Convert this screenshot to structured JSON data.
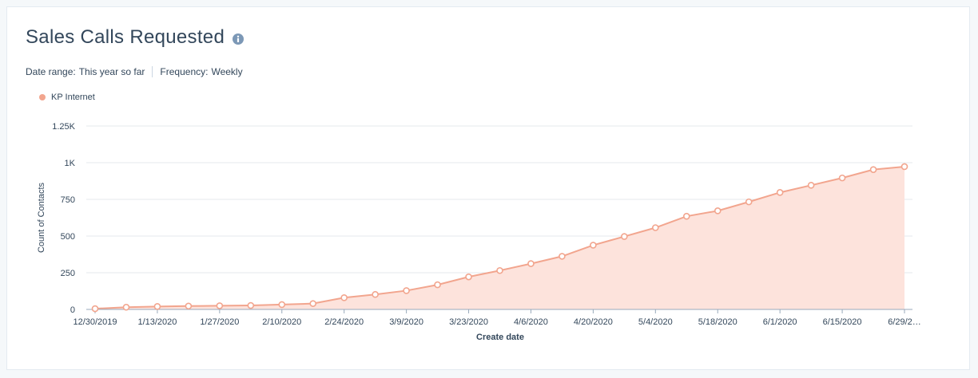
{
  "title": "Sales Calls Requested",
  "filters": {
    "date_range_label": "Date range:",
    "date_range_value": "This year so far",
    "frequency_label": "Frequency:",
    "frequency_value": "Weekly"
  },
  "colors": {
    "series_line": "#f2a58e",
    "series_fill": "#fde3dc",
    "grid": "#e5e9ee",
    "axis": "#99aabb",
    "info_icon": "#7c98b6"
  },
  "chart_data": {
    "type": "area",
    "title": "",
    "xlabel": "Create date",
    "ylabel": "Count of Contacts",
    "ylim": [
      0,
      1250
    ],
    "yticks": [
      0,
      250,
      500,
      750,
      1000,
      1250
    ],
    "ytick_labels": [
      "0",
      "250",
      "500",
      "750",
      "1K",
      "1.25K"
    ],
    "grid": true,
    "legend_position": "top-left",
    "x": [
      "12/30/2019",
      "1/6/2020",
      "1/13/2020",
      "1/20/2020",
      "1/27/2020",
      "2/3/2020",
      "2/10/2020",
      "2/17/2020",
      "2/24/2020",
      "3/2/2020",
      "3/9/2020",
      "3/16/2020",
      "3/23/2020",
      "3/30/2020",
      "4/6/2020",
      "4/13/2020",
      "4/20/2020",
      "4/27/2020",
      "5/4/2020",
      "5/11/2020",
      "5/18/2020",
      "5/25/2020",
      "6/1/2020",
      "6/8/2020",
      "6/15/2020",
      "6/22/2020",
      "6/29/2020"
    ],
    "xtick_labels": [
      "12/30/2019",
      "1/13/2020",
      "1/27/2020",
      "2/10/2020",
      "2/24/2020",
      "3/9/2020",
      "3/23/2020",
      "4/6/2020",
      "4/20/2020",
      "5/4/2020",
      "5/18/2020",
      "6/1/2020",
      "6/15/2020",
      "6/29/2…"
    ],
    "series": [
      {
        "name": "KP Internet",
        "values": [
          5,
          15,
          20,
          23,
          25,
          27,
          33,
          40,
          80,
          102,
          128,
          168,
          222,
          265,
          312,
          362,
          438,
          497,
          557,
          635,
          672,
          733,
          797,
          846,
          896,
          953,
          973
        ]
      }
    ]
  }
}
